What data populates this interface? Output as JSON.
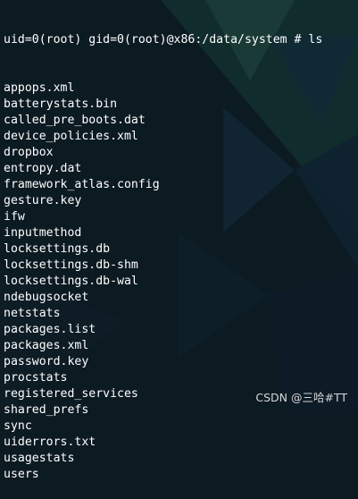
{
  "terminal": {
    "prompt": "uid=0(root) gid=0(root)@x86:/data/system # ls",
    "files": [
      "appops.xml",
      "batterystats.bin",
      "called_pre_boots.dat",
      "device_policies.xml",
      "dropbox",
      "entropy.dat",
      "framework_atlas.config",
      "gesture.key",
      "ifw",
      "inputmethod",
      "locksettings.db",
      "locksettings.db-shm",
      "locksettings.db-wal",
      "ndebugsocket",
      "netstats",
      "packages.list",
      "packages.xml",
      "password.key",
      "procstats",
      "registered_services",
      "shared_prefs",
      "sync",
      "uiderrors.txt",
      "usagestats",
      "users"
    ]
  },
  "watermark": "CSDN @三哈#TT",
  "colors": {
    "background": "#0c1a22",
    "text": "#ffffff",
    "watermark": "#d6d6d6"
  }
}
